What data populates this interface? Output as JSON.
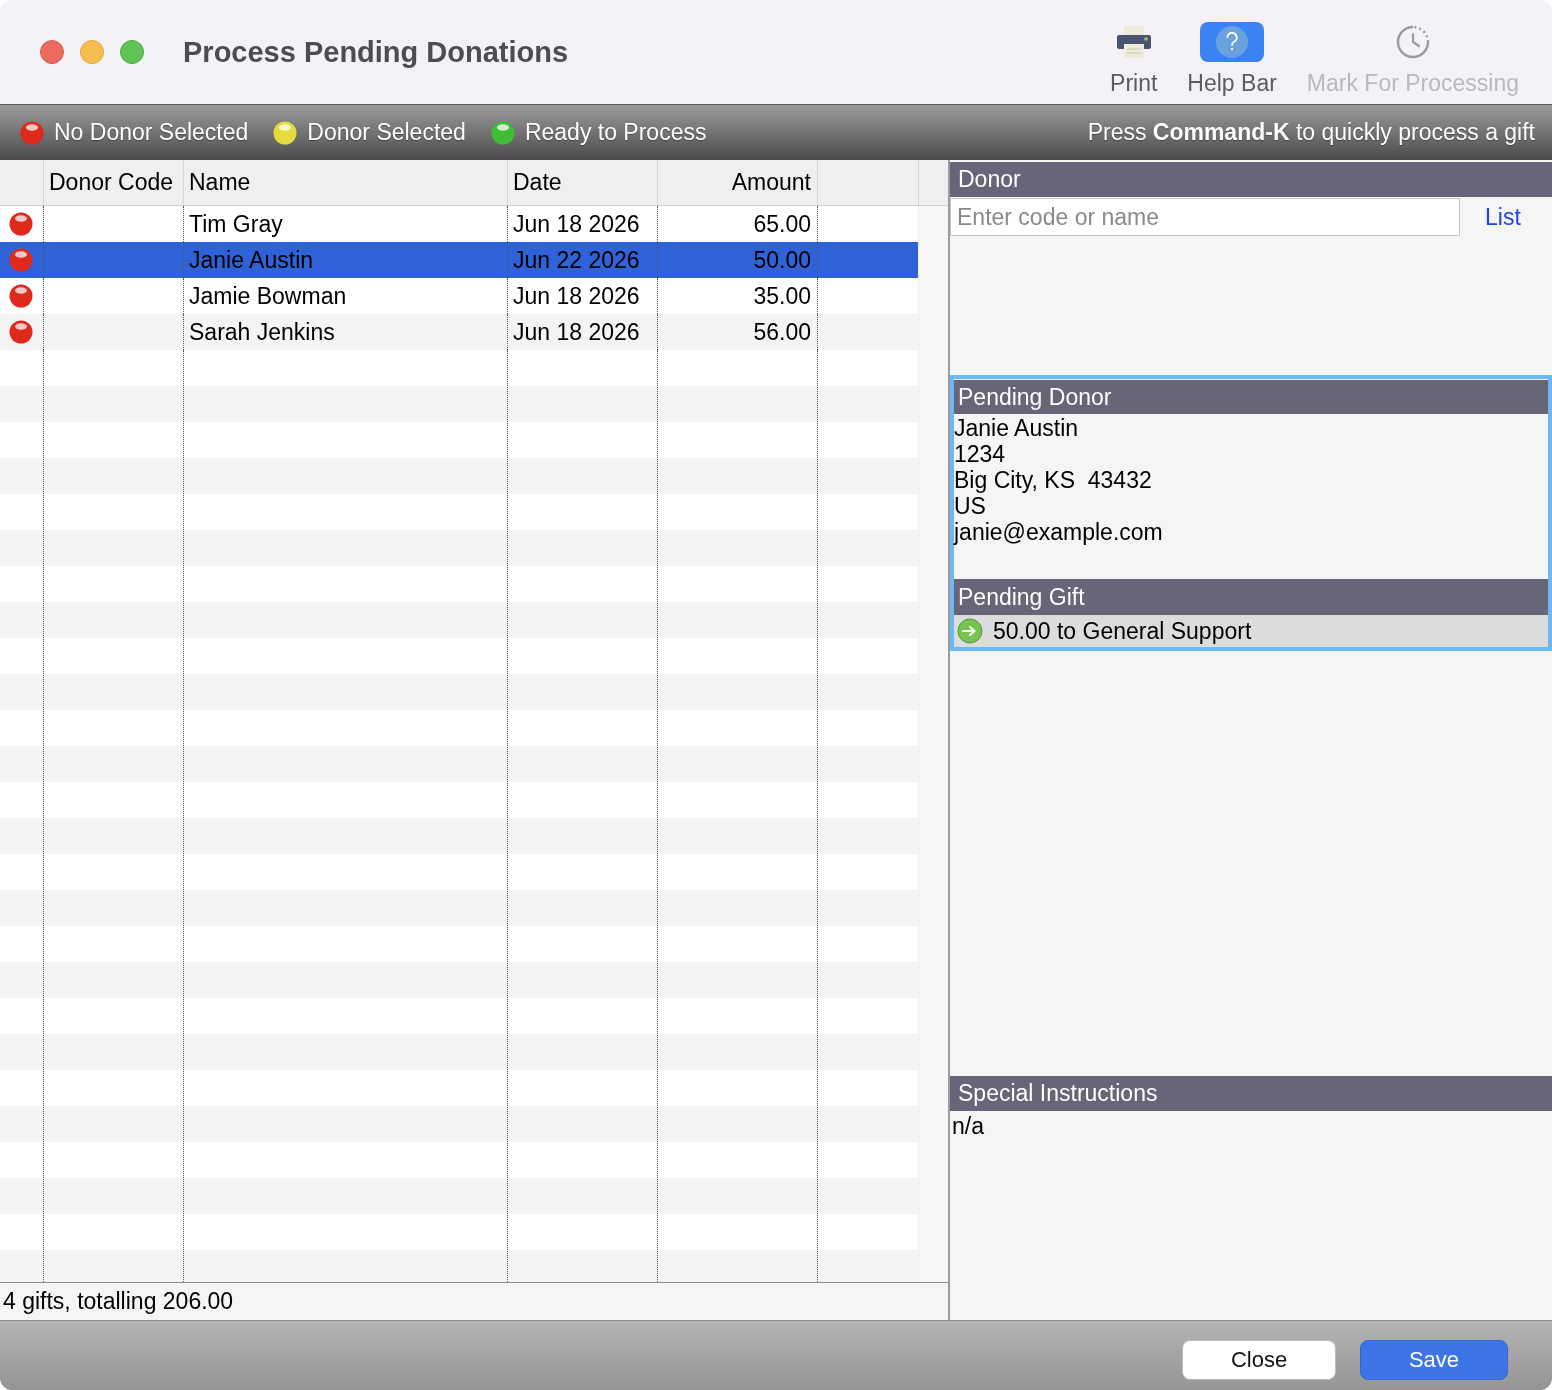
{
  "window": {
    "title": "Process Pending Donations"
  },
  "toolbar": [
    {
      "label": "Print",
      "kind": "print",
      "disabled": false
    },
    {
      "label": "Help Bar",
      "kind": "help",
      "disabled": false
    },
    {
      "label": "Mark For Processing",
      "kind": "mark",
      "disabled": true
    }
  ],
  "legend": {
    "items": [
      {
        "label": "No Donor Selected",
        "color": "#e0291d"
      },
      {
        "label": "Donor Selected",
        "color": "#e3dc3c"
      },
      {
        "label": "Ready to Process",
        "color": "#3ebd35"
      }
    ],
    "hint": "Press **Command-K** to quickly process a gift"
  },
  "table": {
    "columns": [
      "Donor Code",
      "Name",
      "Date",
      "Amount"
    ],
    "rows": [
      {
        "color": "#e0291d",
        "name": "Tim Gray",
        "date": "Jun 18 2026",
        "amount": "65.00",
        "selected": false
      },
      {
        "color": "#e0291d",
        "name": "Janie Austin",
        "date": "Jun 22 2026",
        "amount": "50.00",
        "selected": true
      },
      {
        "color": "#e0291d",
        "name": "Jamie Bowman",
        "date": "Jun 18 2026",
        "amount": "35.00",
        "selected": false
      },
      {
        "color": "#e0291d",
        "name": "Sarah Jenkins",
        "date": "Jun 18 2026",
        "amount": "56.00",
        "selected": false
      }
    ]
  },
  "status_bar": {
    "summary": "4 gifts, totalling 206.00"
  },
  "donor": {
    "title": "Donor",
    "search": {
      "placeholder": "Enter code or name"
    },
    "list_link": "List"
  },
  "pending": {
    "focused": true,
    "donor_title": "Pending Donor",
    "donor_lines": [
      "Janie Austin",
      "1234",
      "Big City, KS  43432",
      "US",
      "janie@example.com"
    ],
    "gift_title": "Pending Gift",
    "gifts": [
      "50.00 to General Support"
    ]
  },
  "special_instructions": {
    "title": "Special Instructions",
    "text": "n/a"
  },
  "buttons": [
    {
      "label": "Close",
      "kind": "default"
    },
    {
      "label": "Save",
      "kind": "primary"
    }
  ]
}
